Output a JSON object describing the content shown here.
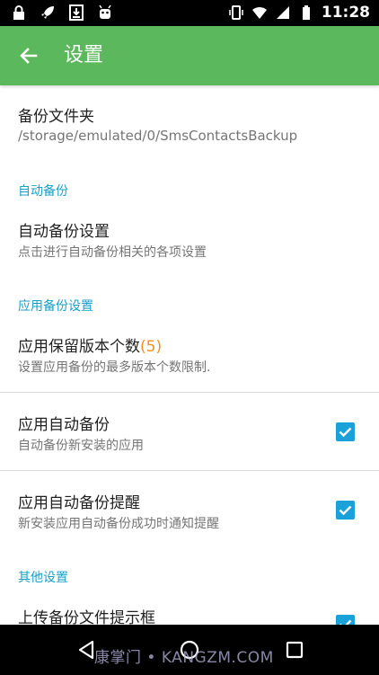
{
  "status_bar": {
    "time": "11:28",
    "left_icons": [
      "lock-icon",
      "rocket-icon",
      "download-icon",
      "android-icon"
    ],
    "right_icons": [
      "vibrate-icon",
      "wifi-icon",
      "signal-icon",
      "battery-icon"
    ]
  },
  "app_bar": {
    "title": "设置",
    "back_icon": "arrow-left-icon",
    "background": "#5cb85c"
  },
  "settings": {
    "backup_folder": {
      "title": "备份文件夹",
      "summary": "/storage/emulated/0/SmsContactsBackup"
    },
    "section_auto_backup": "自动备份",
    "auto_backup_settings": {
      "title": "自动备份设置",
      "summary": "点击进行自动备份相关的各项设置"
    },
    "section_app_backup": "应用备份设置",
    "app_keep_versions": {
      "title": "应用保留版本个数",
      "count": "(5)",
      "summary": "设置应用备份的最多版本个数限制."
    },
    "app_auto_backup": {
      "title": "应用自动备份",
      "summary": "自动备份新安装的应用",
      "checked": true
    },
    "app_auto_backup_notify": {
      "title": "应用自动备份提醒",
      "summary": "新安装应用自动备份成功时通知提醒",
      "checked": true
    },
    "section_other": "其他设置",
    "upload_prompt": {
      "title": "上传备份文件提示框",
      "checked": true
    }
  },
  "nav_bar": {
    "icons": [
      "back-triangle-icon",
      "home-circle-icon",
      "recents-square-icon"
    ],
    "watermark": "康掌门 • KANGZM.COM"
  },
  "colors": {
    "accent": "#1aa1d9",
    "section_header": "#18a0c8",
    "count_highlight": "#f0901d"
  }
}
